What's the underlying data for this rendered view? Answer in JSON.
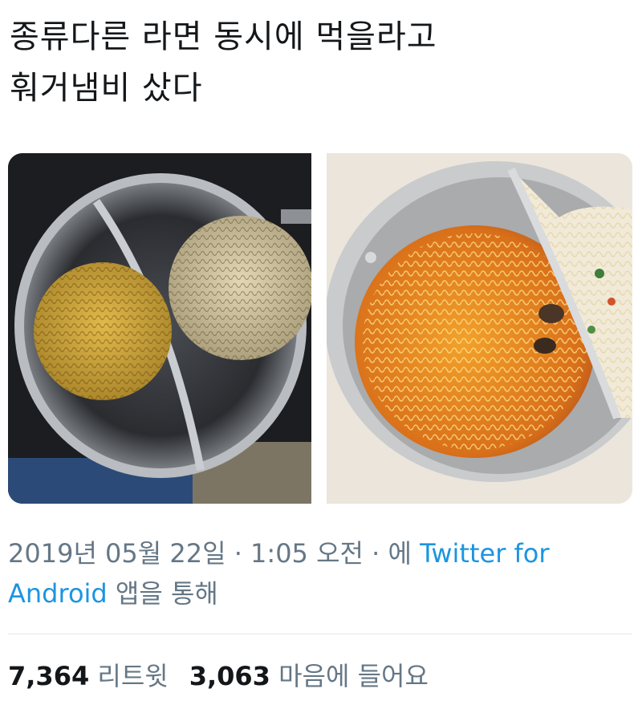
{
  "tweet": {
    "text_line1": "종류다른 라면 동시에 먹을라고",
    "text_line2": "훠거냄비 샀다"
  },
  "media": {
    "photo1_alt": "",
    "photo2_alt": ""
  },
  "meta": {
    "timestamp": "2019년 05월 22일 · 1:05 오전 · 에",
    "source_link": "Twitter for Android",
    "source_suffix": "앱을 통해"
  },
  "stats": {
    "retweets_count": "7,364",
    "retweets_label": "리트윗",
    "likes_count": "3,063",
    "likes_label": "마음에 들어요"
  },
  "colors": {
    "link": "#1b95e0",
    "secondary_text": "#657786",
    "primary_text": "#14171a"
  }
}
